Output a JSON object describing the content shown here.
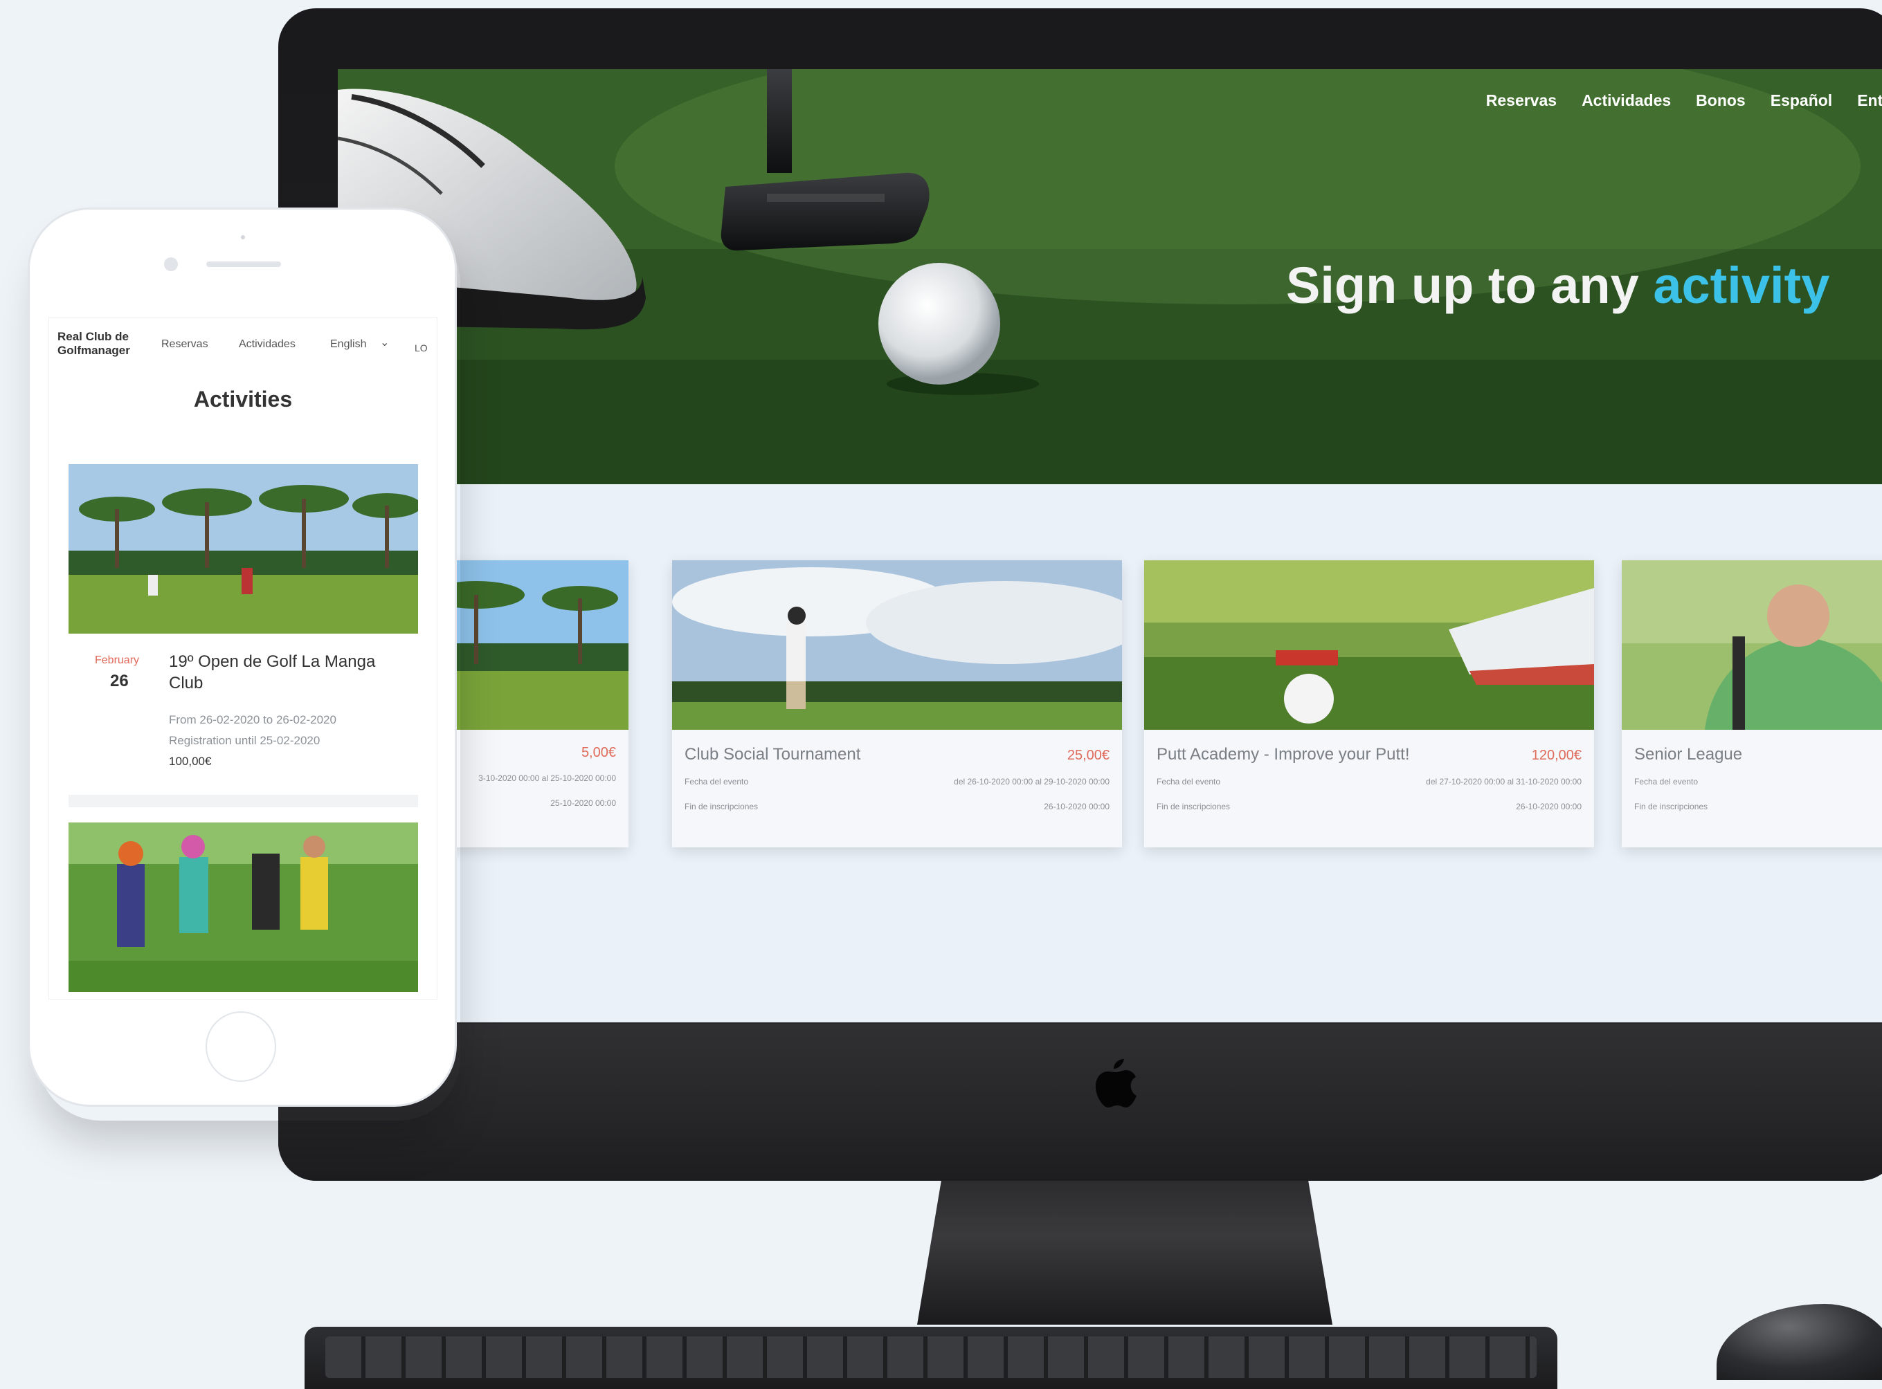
{
  "desktop": {
    "nav": [
      "Reservas",
      "Actividades",
      "Bonos",
      "Español",
      "Entra"
    ],
    "hero": {
      "title_pre": "Sign up to any ",
      "title_accent": "activity"
    },
    "cards": [
      {
        "title": "",
        "price": "5,00€",
        "row1_label": "",
        "row1_value": "3-10-2020 00:00 al 25-10-2020 00:00",
        "row2_label": "",
        "row2_value": "25-10-2020 00:00"
      },
      {
        "title": "Club Social Tournament",
        "price": "25,00€",
        "row1_label": "Fecha del evento",
        "row1_value": "del 26-10-2020 00:00 al 29-10-2020 00:00",
        "row2_label": "Fin de inscripciones",
        "row2_value": "26-10-2020 00:00"
      },
      {
        "title": "Putt Academy - Improve your Putt!",
        "price": "120,00€",
        "row1_label": "Fecha del evento",
        "row1_value": "del 27-10-2020 00:00 al 31-10-2020 00:00",
        "row2_label": "Fin de inscripciones",
        "row2_value": "26-10-2020 00:00"
      },
      {
        "title": "Senior League",
        "price": "",
        "row1_label": "Fecha del evento",
        "row1_value": "",
        "row2_label": "Fin de inscripciones",
        "row2_value": ""
      }
    ]
  },
  "mobile": {
    "brand_line1": "Real Club de",
    "brand_line2": "Golfmanager",
    "nav": [
      "Reservas",
      "Actividades",
      "English"
    ],
    "nav_overflow": "LO",
    "heading": "Activities",
    "event": {
      "month": "February",
      "day": "26",
      "title": "19º Open de Golf La Manga Club",
      "dates": "From 26-02-2020 to 26-02-2020",
      "registration": "Registration until 25-02-2020",
      "price": "100,00€"
    }
  },
  "icons": [
    "apple-logo-icon",
    "chevron-down-icon"
  ],
  "colors": {
    "accent": "#3cc2e8",
    "price": "#e06a5a",
    "month": "#e2685a"
  }
}
